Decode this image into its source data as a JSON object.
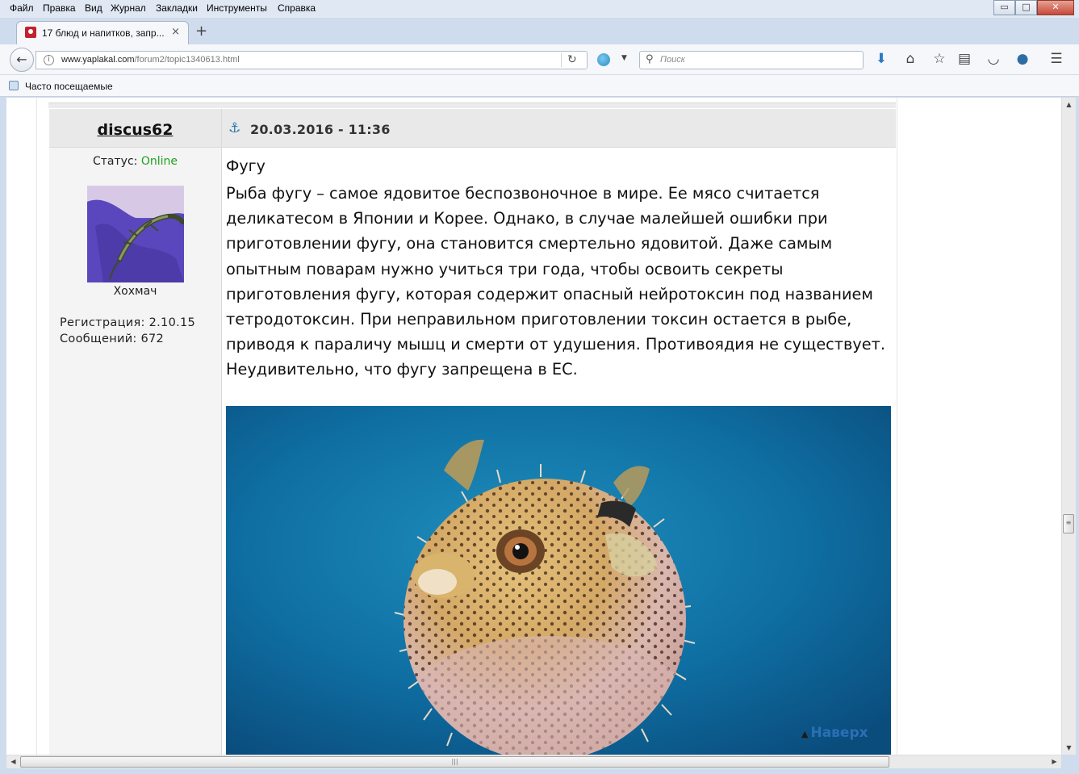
{
  "menu": [
    "Файл",
    "Правка",
    "Вид",
    "Журнал",
    "Закладки",
    "Инструменты",
    "Справка"
  ],
  "window_controls": {
    "minimize": "▭",
    "maximize": "□",
    "close": "✕"
  },
  "tab": {
    "title": "17 блюд и напитков, запр...",
    "close": "×",
    "new_tab": "+"
  },
  "navbar": {
    "back": "←",
    "url_domain": "www.yaplakal.com",
    "url_path": "/forum2/topic1340613.html",
    "reload": "C",
    "search_placeholder": "Поиск",
    "icons": [
      "download-icon",
      "home-icon",
      "bookmark-star-icon",
      "reading-list-icon",
      "pocket-icon",
      "globe-icon",
      "menu-icon"
    ]
  },
  "bookmarks": {
    "label": "Часто посещаемые"
  },
  "post": {
    "author": "discus62",
    "date": "20.03.2016 - 11:36",
    "status_label": "Статус:",
    "status_value": "Online",
    "avatar_name": "Хохмач",
    "registration": "Регистрация: 2.10.15",
    "messages": "Сообщений: 672",
    "title": "Фугу",
    "body": "Рыба фугу – самое ядовитое беспозвоночное в мире. Ее мясо считается деликатесом в Японии и Корее. Однако, в случае малейшей ошибки при приготовлении фугу, она становится смертельно ядовитой. Даже самым опытным поварам нужно учиться три года, чтобы освоить секреты приготовления фугу, которая содержит опасный нейротоксин под названием тетродотоксин. При неправильном приготовлении токсин остается в рыбе, приводя к параличу мышц и смерти от удушения. Противоядия не существует. Неудивительно, что фугу запрещена в ЕС.",
    "to_top": "Наверх"
  },
  "colors": {
    "accent": "#2d6fb3",
    "online": "#1fa21f",
    "chrome": "#cfdced"
  }
}
